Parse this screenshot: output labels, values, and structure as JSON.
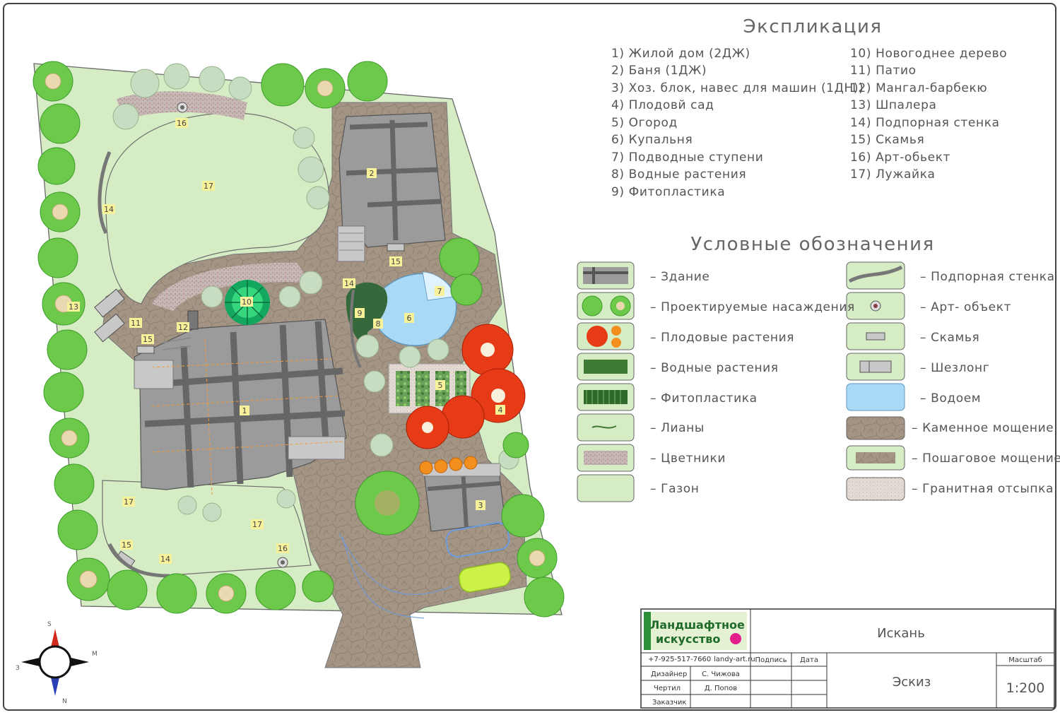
{
  "explication": {
    "title": "Экспликация",
    "items": [
      "1) Жилой дом (2ДЖ)",
      "2) Баня (1ДЖ)",
      "3) Хоз. блок, навес для машин (1ДН))",
      "4) Плодовй сад",
      "5) Огород",
      "6) Купальня",
      "7) Подводные ступени",
      "8) Водные растения",
      "9) Фитопластика",
      "10) Новогоднее дерево",
      "11) Патио",
      "12) Мангал-барбекю",
      "13) Шпалера",
      "14) Подпорная стенка",
      "15) Скамья",
      "16) Арт-обьект",
      "17) Лужайка"
    ]
  },
  "legend": {
    "title": "Условные обозначения",
    "items": [
      {
        "label": "– Здание",
        "icon": "building-symbol"
      },
      {
        "label": "– Проектируемые насаждения",
        "icon": "planting-symbol"
      },
      {
        "label": "– Плодовые растения",
        "icon": "fruit-plant-symbol"
      },
      {
        "label": "– Водные растения",
        "icon": "water-plant-symbol"
      },
      {
        "label": "– Фитопластика",
        "icon": "phytoplastic-symbol"
      },
      {
        "label": "– Лианы",
        "icon": "liana-symbol"
      },
      {
        "label": "– Цветники",
        "icon": "flowerbed-symbol"
      },
      {
        "label": "– Газон",
        "icon": "lawn-symbol"
      },
      {
        "label": "– Подпорная стенка",
        "icon": "retaining-wall-symbol"
      },
      {
        "label": "– Арт- объект",
        "icon": "art-object-symbol"
      },
      {
        "label": "– Скамья",
        "icon": "bench-symbol"
      },
      {
        "label": "– Шезлонг",
        "icon": "lounger-symbol"
      },
      {
        "label": "– Водоем",
        "icon": "pond-symbol"
      },
      {
        "label": "– Каменное мощение",
        "icon": "stone-paving-symbol"
      },
      {
        "label": "– Пошаговое мощение",
        "icon": "step-paving-symbol"
      },
      {
        "label": "– Гранитная отсыпка",
        "icon": "granite-fill-symbol"
      }
    ]
  },
  "plan_labels": {
    "house": "1",
    "bath": "2",
    "utility": "3",
    "orchard": "4",
    "vegetable": "5",
    "pond": "6",
    "steps": "7",
    "water_plants": "8",
    "phyto": "9",
    "tree": "10",
    "patio": "11",
    "bbq": "12",
    "trellis": "13",
    "wall_a": "14",
    "wall_b": "14",
    "wall_c": "14",
    "bench_a": "15",
    "bench_b": "15",
    "bench_c": "15",
    "art_a": "16",
    "art_b": "16",
    "lawn_a": "17",
    "lawn_b": "17",
    "lawn_c": "17"
  },
  "compass": {
    "s": "S",
    "w": "З",
    "e": "М",
    "n": "N"
  },
  "title_block": {
    "logo_line1": "Ландшафтное",
    "logo_line2": "искусство",
    "phone": "+7-925-517-7660",
    "site": "landy-art.ru",
    "project": "Искань",
    "sheet": "Эскиз",
    "col_sign": "Подпись",
    "col_date": "Дата",
    "scale_label": "Масштаб",
    "scale": "1:200",
    "rows": [
      {
        "role": "Дизайнер",
        "name": "С. Чижова"
      },
      {
        "role": "Чертил",
        "name": "Д. Попов"
      },
      {
        "role": "Заказчик",
        "name": ""
      }
    ]
  },
  "colors": {
    "lawn": "#d6ecc4",
    "paving": "#a39484",
    "building": "#9b9b9b",
    "water": "#a9d9f5",
    "plant": "#6cc94a",
    "fruit": "#e63b16",
    "accent": "#e31d8c"
  }
}
